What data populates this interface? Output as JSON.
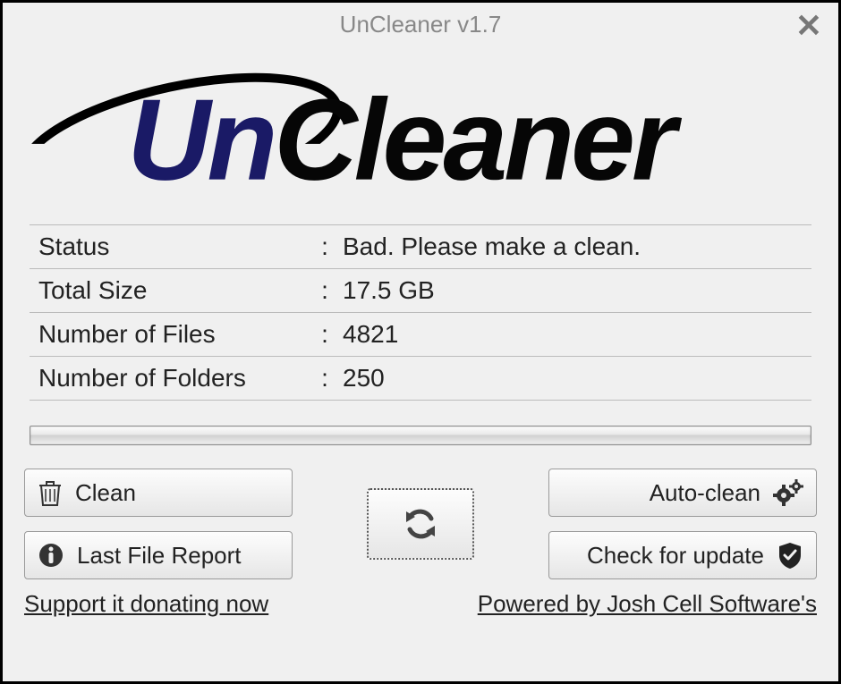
{
  "window": {
    "title": "UnCleaner v1.7"
  },
  "logo": {
    "text": "UnCleaner"
  },
  "stats": {
    "status": {
      "label": "Status",
      "value": "Bad. Please make a clean."
    },
    "total_size": {
      "label": "Total Size",
      "value": "17.5 GB"
    },
    "num_files": {
      "label": "Number of Files",
      "value": "4821"
    },
    "num_folders": {
      "label": "Number of Folders",
      "value": "250"
    }
  },
  "buttons": {
    "clean": "Clean",
    "last_report": "Last File Report",
    "auto_clean": "Auto-clean",
    "check_update": "Check for update"
  },
  "links": {
    "donate": "Support it donating now",
    "powered": "Powered by Josh Cell Software's"
  }
}
